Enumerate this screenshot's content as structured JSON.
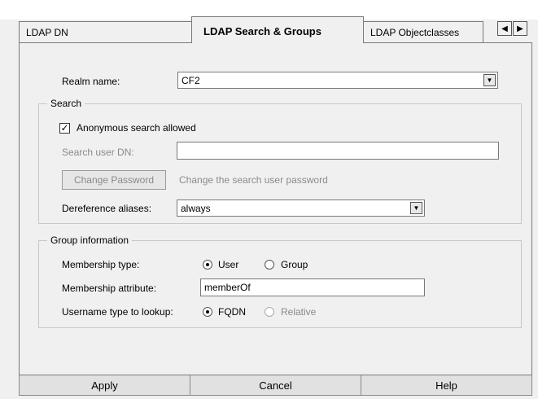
{
  "tabs": [
    {
      "label": "LDAP DN",
      "active": false
    },
    {
      "label": "LDAP Search & Groups",
      "active": true
    },
    {
      "label": "LDAP Objectclasses",
      "active": false
    }
  ],
  "realm": {
    "label": "Realm name:",
    "value": "CF2"
  },
  "search": {
    "title": "Search",
    "anonymous_label": "Anonymous search allowed",
    "anonymous_checked": true,
    "user_dn_label": "Search user DN:",
    "user_dn_value": "",
    "change_password_label": "Change Password",
    "change_password_desc": "Change the search user password",
    "deref_label": "Dereference aliases:",
    "deref_value": "always"
  },
  "group_info": {
    "title": "Group information",
    "membership_type_label": "Membership type:",
    "membership_type_options": [
      "User",
      "Group"
    ],
    "membership_type_selected": "User",
    "membership_attr_label": "Membership attribute:",
    "membership_attr_value": "memberOf",
    "username_type_label": "Username type to lookup:",
    "username_type_options": [
      "FQDN",
      "Relative"
    ],
    "username_type_selected": "FQDN"
  },
  "buttons": {
    "apply": "Apply",
    "cancel": "Cancel",
    "help": "Help"
  },
  "icons": {
    "tab_left": "arrow-left-icon",
    "tab_right": "arrow-right-icon",
    "dropdown": "chevron-down-icon",
    "check": "checkmark-icon"
  }
}
